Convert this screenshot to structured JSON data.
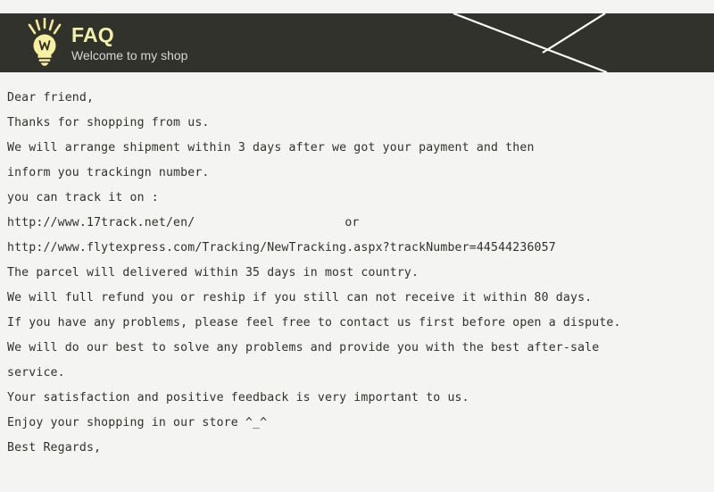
{
  "colors": {
    "page_background": "#f4f4f2",
    "banner_background": "#32322d",
    "brand_title": "#f2f0a8",
    "brand_subtitle": "#d6d6d2",
    "body_text": "#31312c",
    "deco_line": "#ffffff",
    "bulb_fill": "#f7f0a0",
    "bulb_outline": "#e8dd74"
  },
  "banner": {
    "icon": "lightbulb-icon",
    "title": "FAQ",
    "subtitle": "Welcome to my shop"
  },
  "body": {
    "lines": [
      {
        "text": "Dear friend,"
      },
      {
        "text": "Thanks for shopping from us."
      },
      {
        "text": "We will arrange shipment within 3 days after we got your payment and then"
      },
      {
        "text": "inform you trackingn number."
      },
      {
        "text": "you can track it on :"
      },
      {
        "text": "http://www.17track.net/en/",
        "tail": "or"
      },
      {
        "text": "http://www.flytexpress.com/Tracking/NewTracking.aspx?trackNumber=44544236057"
      },
      {
        "text": "The parcel will delivered within 35 days in most country."
      },
      {
        "text": "We will full refund you or reship if you still can not receive it within 80 days."
      },
      {
        "text": "If you have any problems, please feel free to contact us first before open a dispute."
      },
      {
        "text": "We will do our best to solve any problems and provide you with the best after-sale"
      },
      {
        "text": "service."
      },
      {
        "text": "Your satisfaction and positive feedback is very important to us."
      },
      {
        "text": "Enjoy your shopping in our store ^_^"
      },
      {
        "text": "Best Regards,"
      }
    ]
  }
}
